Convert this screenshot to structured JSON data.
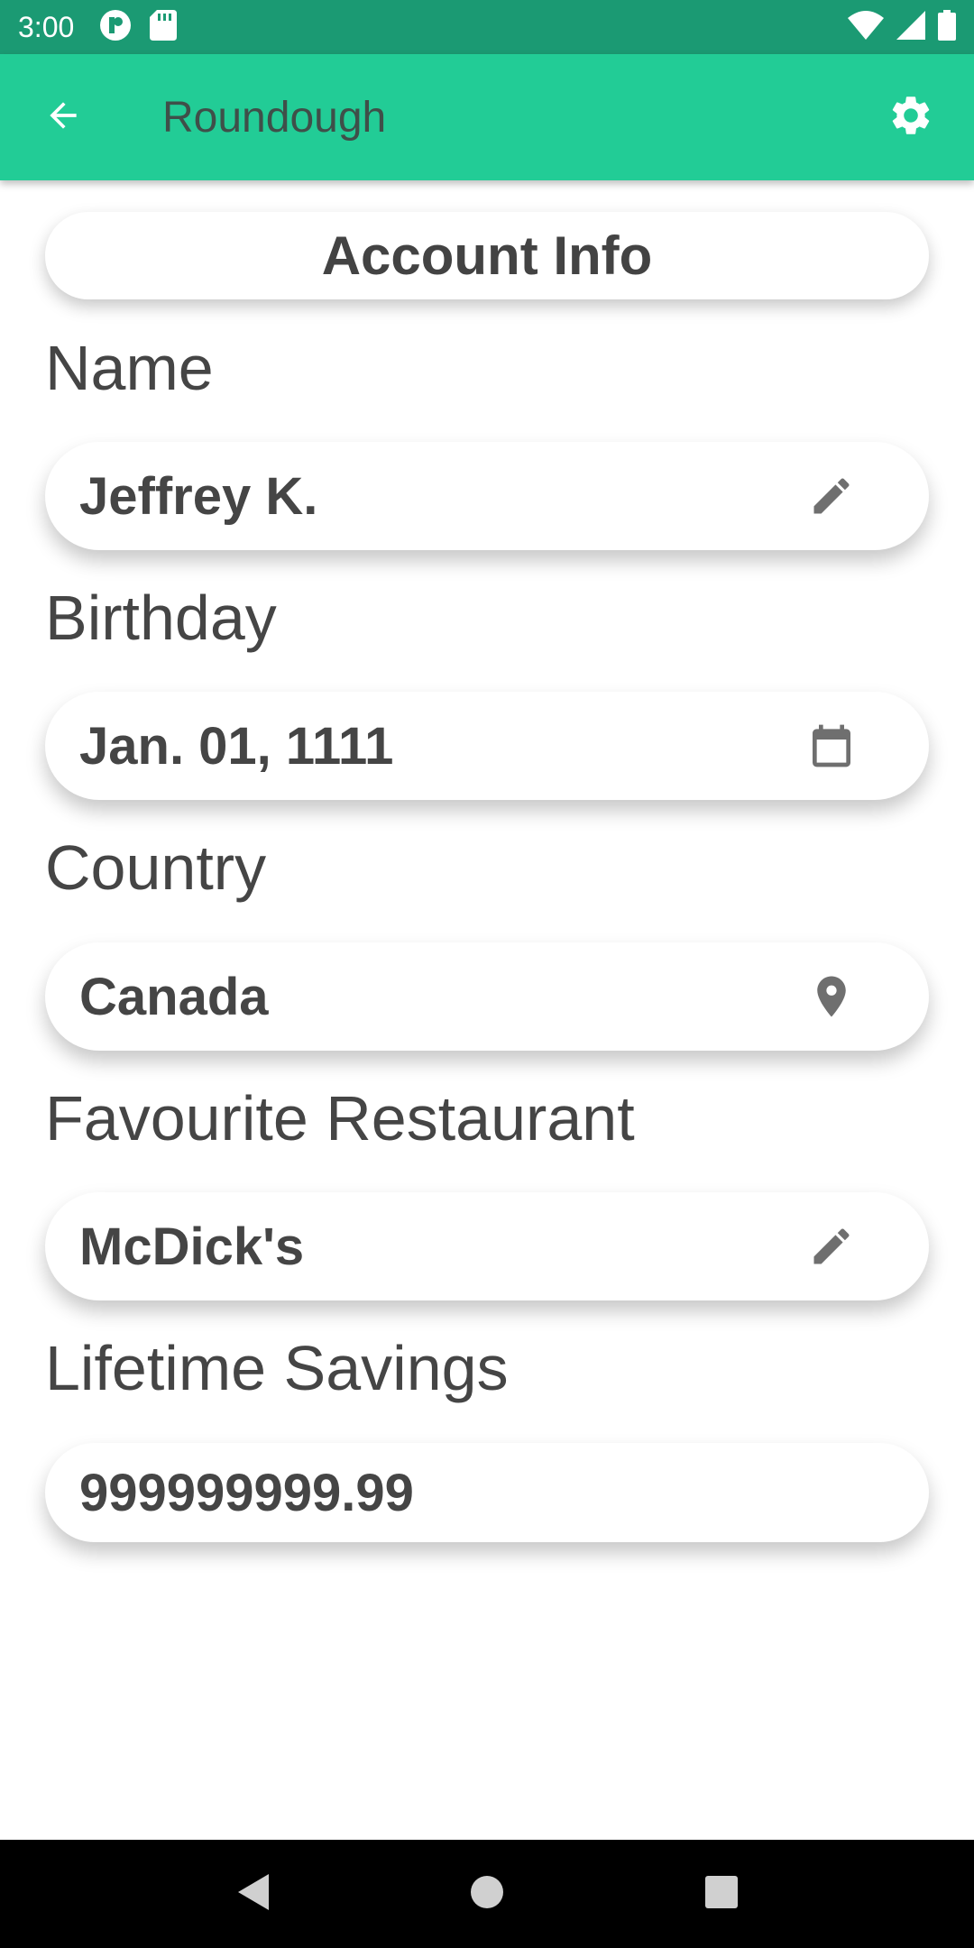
{
  "status_bar": {
    "time": "3:00",
    "icons": [
      "notification-app-icon",
      "sd-card-icon",
      "wifi-icon",
      "cellular-signal-icon",
      "battery-icon"
    ]
  },
  "app_bar": {
    "title": "Roundough",
    "back_icon": "arrow-back-icon",
    "settings_icon": "gear-icon",
    "color": "#22cc96"
  },
  "header": {
    "title": "Account Info"
  },
  "fields": [
    {
      "label": "Name",
      "value": "Jeffrey K.",
      "icon": "edit-pencil-icon"
    },
    {
      "label": "Birthday",
      "value": "Jan. 01, 1111",
      "icon": "calendar-icon"
    },
    {
      "label": "Country",
      "value": "Canada",
      "icon": "location-pin-icon"
    },
    {
      "label": "Favourite Restaurant",
      "value": "McDick's",
      "icon": "edit-pencil-icon"
    },
    {
      "label": "Lifetime Savings",
      "value": "999999999.99",
      "icon": ""
    }
  ],
  "nav_bar": {
    "buttons": [
      "back-triangle-icon",
      "home-circle-icon",
      "recents-square-icon"
    ]
  }
}
